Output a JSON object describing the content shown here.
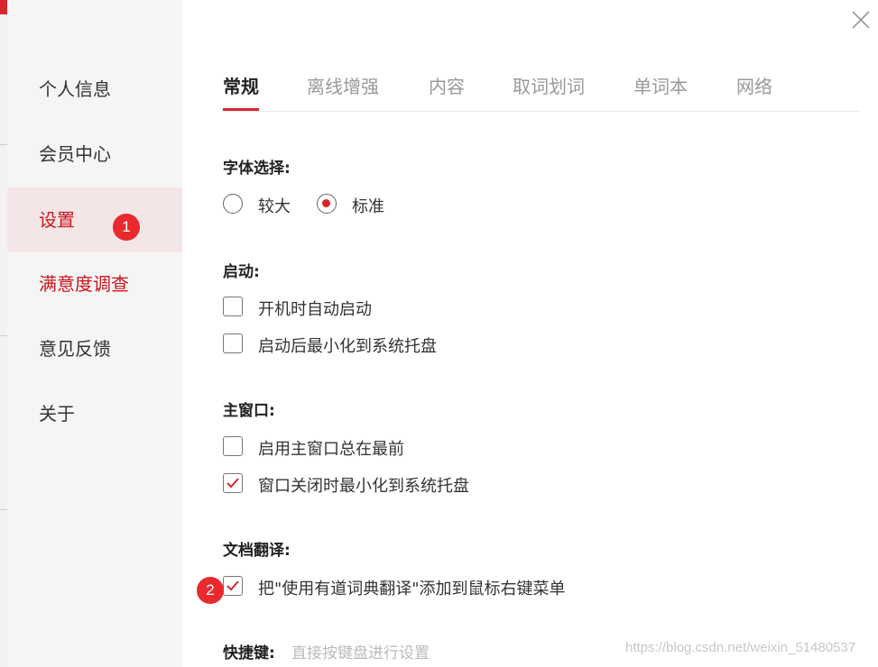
{
  "sidebar": {
    "items": [
      {
        "label": "个人信息"
      },
      {
        "label": "会员中心"
      },
      {
        "label": "设置"
      },
      {
        "label": "满意度调查"
      },
      {
        "label": "意见反馈"
      },
      {
        "label": "关于"
      }
    ]
  },
  "annotations": {
    "badge1": "1",
    "badge2": "2"
  },
  "tabs": [
    {
      "label": "常规"
    },
    {
      "label": "离线增强"
    },
    {
      "label": "内容"
    },
    {
      "label": "取词划词"
    },
    {
      "label": "单词本"
    },
    {
      "label": "网络"
    }
  ],
  "font": {
    "title": "字体选择:",
    "options": [
      {
        "label": "较大",
        "checked": false
      },
      {
        "label": "标准",
        "checked": true
      }
    ]
  },
  "startup": {
    "title": "启动:",
    "options": [
      {
        "label": "开机时自动启动",
        "checked": false
      },
      {
        "label": "启动后最小化到系统托盘",
        "checked": false
      }
    ]
  },
  "main_window": {
    "title": "主窗口:",
    "options": [
      {
        "label": "启用主窗口总在最前",
        "checked": false
      },
      {
        "label": "窗口关闭时最小化到系统托盘",
        "checked": true
      }
    ]
  },
  "doc_translate": {
    "title": "文档翻译:",
    "options": [
      {
        "label": "把\"使用有道词典翻译\"添加到鼠标右键菜单",
        "checked": true
      }
    ]
  },
  "shortcut": {
    "title": "快捷键:",
    "hint": "直接按键盘进行设置"
  },
  "watermark": "https://blog.csdn.net/weixin_51480537",
  "colors": {
    "accent": "#d9262c",
    "badge": "#e8292e",
    "sidebar_bg": "#f5f5f5",
    "active_bg": "#f4e6e6"
  }
}
